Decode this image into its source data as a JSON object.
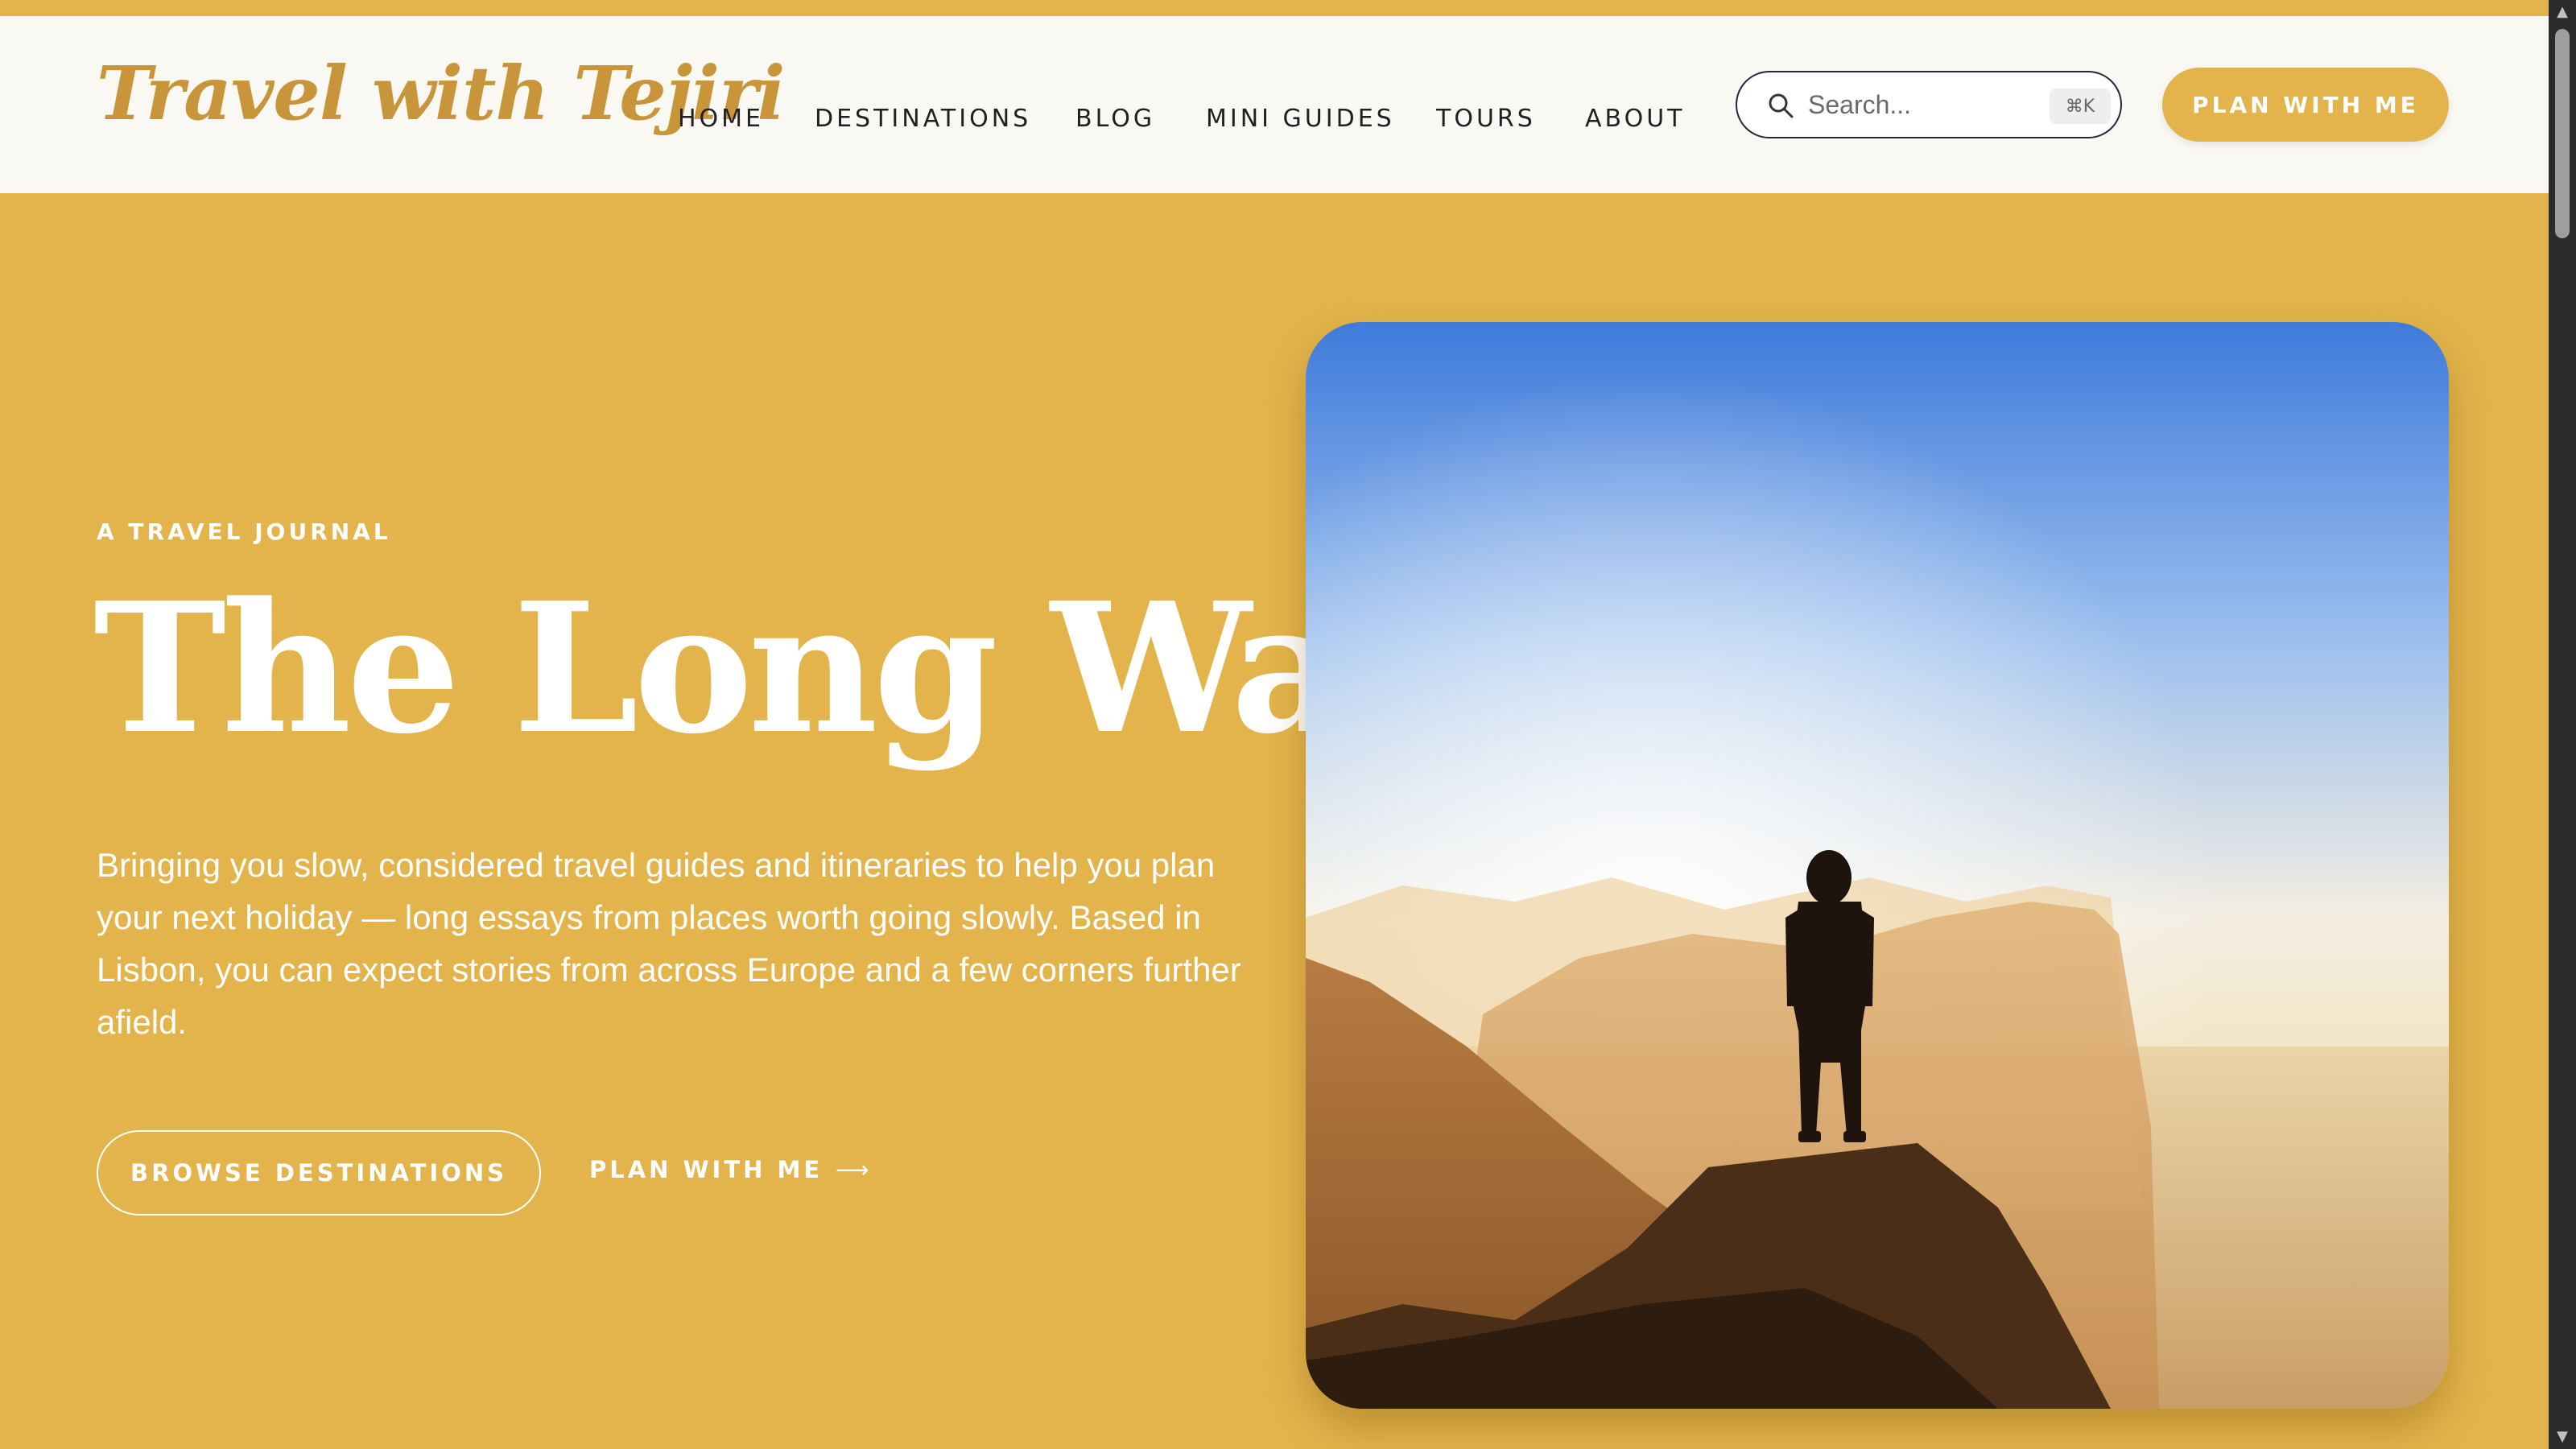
{
  "header": {
    "logo": "Travel with Tejiri",
    "nav": [
      "HOME",
      "DESTINATIONS",
      "BLOG",
      "MINI GUIDES",
      "TOURS",
      "ABOUT"
    ],
    "search": {
      "placeholder": "Search...",
      "shortcut": "⌘K"
    },
    "cta": "PLAN WITH ME"
  },
  "hero": {
    "eyebrow": "A TRAVEL JOURNAL",
    "title": "The Long Way",
    "description": "Bringing you slow, considered travel guides and itineraries to help you plan your next holiday — long essays from places worth going slowly. Based in Lisbon, you can expect stories from across Europe and a few corners further afield.",
    "primary_button": "BROWSE DESTINATIONS",
    "secondary_link": "PLAN WITH ME",
    "secondary_link_arrow": "⟶"
  },
  "scrollbar": {
    "up": "▲",
    "down": "▼"
  },
  "colors": {
    "accent": "#E2B44B",
    "logo": "#C9953A",
    "header_bg": "#FAF8F3",
    "text_dark": "#1F1F24"
  },
  "icons": {
    "search": "search-icon",
    "arrow": "arrow-right-icon"
  }
}
